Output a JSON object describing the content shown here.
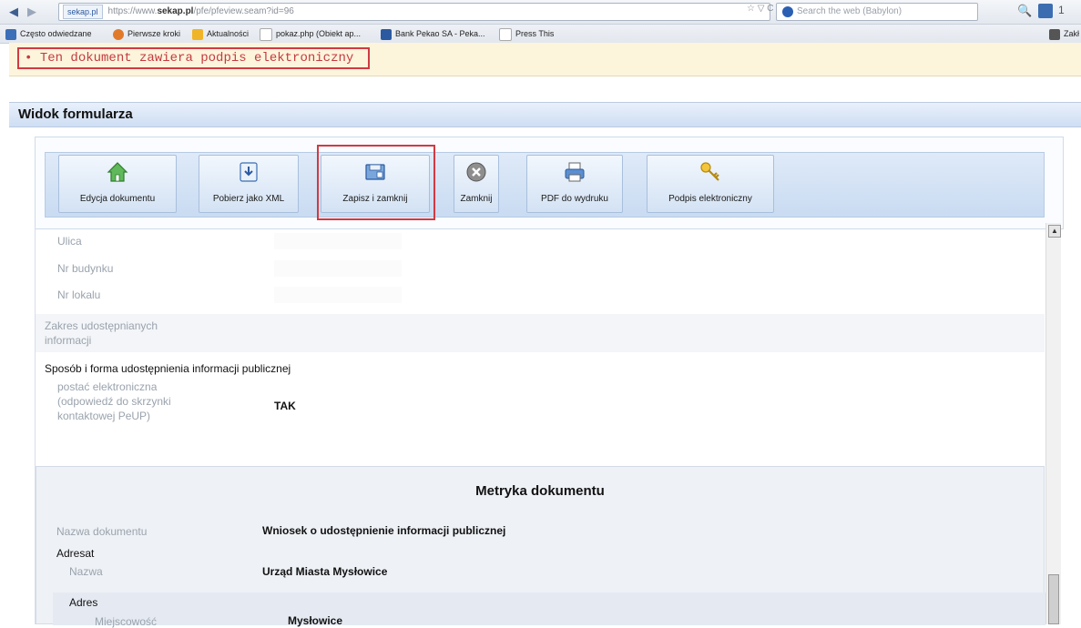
{
  "browser": {
    "back": "◀",
    "forward": "▶",
    "site_chip": "sekap.pl",
    "url_prefix": "https://www.",
    "url_domain": "sekap.pl",
    "url_rest": "/pfe/pfeview.seam?id=96",
    "url_actions": "☆ ▽ C",
    "search_placeholder": "Search the web (Babylon)",
    "search_go": "🔍",
    "ext_more": "1"
  },
  "bookmarks": {
    "items": [
      {
        "label": "Często odwiedzane",
        "color": "#3b6fb8"
      },
      {
        "label": "Pierwsze kroki",
        "color": "#e07a2a"
      },
      {
        "label": "Aktualności",
        "color": "#f0b429"
      },
      {
        "label": "pokaz.php (Obiekt ap...",
        "color": "#cccccc"
      },
      {
        "label": "Bank Pekao SA - Peka...",
        "color": "#2b5aa0"
      },
      {
        "label": "Press This",
        "color": "#cccccc"
      }
    ],
    "right_label": "Zakł"
  },
  "banner": {
    "bullet": "•",
    "message": "Ten dokument zawiera podpis elektroniczny"
  },
  "form": {
    "title": "Widok formularza"
  },
  "toolbar": {
    "buttons": [
      {
        "label": "Edycja dokumentu",
        "icon": "home-icon"
      },
      {
        "label": "Pobierz jako XML",
        "icon": "download-icon"
      },
      {
        "label": "Zapisz i zamknij",
        "icon": "save-close-icon"
      },
      {
        "label": "Zamknij",
        "icon": "close-icon"
      },
      {
        "label": "PDF do wydruku",
        "icon": "printer-icon"
      },
      {
        "label": "Podpis elektroniczny",
        "icon": "key-icon"
      }
    ]
  },
  "fields": {
    "ulica": "Ulica",
    "nr_budynku": "Nr budynku",
    "nr_lokalu": "Nr lokalu",
    "zakres_1": "Zakres udostępnianych",
    "zakres_2": "informacji",
    "sposob": "Sposób i forma udostępnienia informacji publicznej",
    "postac_1": "postać elektroniczna",
    "postac_2": "(odpowiedź do skrzynki",
    "postac_3": "kontaktowej PeUP)",
    "postac_value": "TAK"
  },
  "metryka": {
    "title": "Metryka dokumentu",
    "nazwa_label": "Nazwa dokumentu",
    "nazwa_value": "Wniosek o udostępnienie informacji publicznej",
    "adresat": "Adresat",
    "adresat_nazwa_label": "Nazwa",
    "adresat_nazwa_value": "Urząd Miasta Mysłowice",
    "adres": "Adres",
    "miejscowosc_label": "Miejscowość",
    "miejscowosc_value": "Mysłowice"
  },
  "colors": {
    "highlight": "#d03a42",
    "banner_bg": "#fdf4dc",
    "toolbar_strip": "#c9dbf2"
  }
}
